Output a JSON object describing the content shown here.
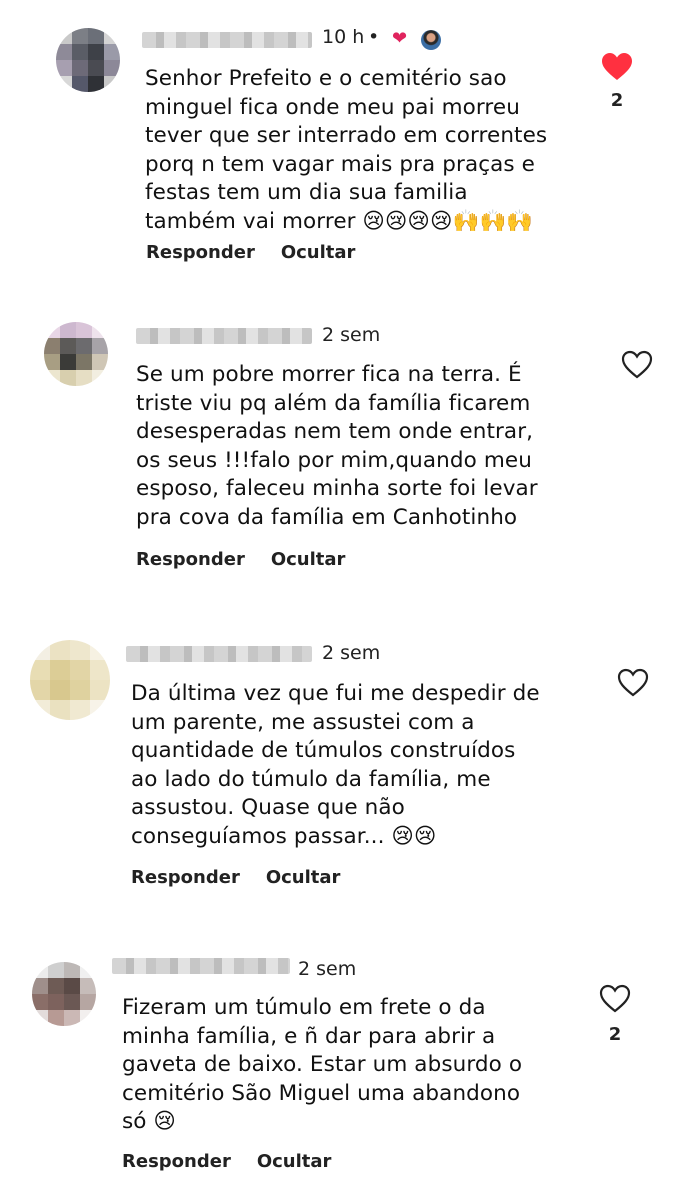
{
  "comments": [
    {
      "time": "10 h",
      "creator_liked": true,
      "text": "Senhor Prefeito e o cemitério sao\nminguel fica onde meu pai morreu\ntever que ser interrado em correntes\nporq n tem vagar mais pra praças e\nfestas tem um dia sua familia\ntambém vai morrer 😢😢😢😢🙌🙌🙌",
      "reply_label": "Responder",
      "hide_label": "Ocultar",
      "liked": true,
      "like_count": "2",
      "like_icon": "heart-filled"
    },
    {
      "time": "2 sem",
      "text": "Se um pobre morrer fica na terra. É\ntriste viu pq além da família ficarem\ndesesperadas nem tem onde entrar,\nos seus !!!falo por mim,quando meu\nesposo, faleceu minha sorte foi levar\npra cova da família em Canhotinho",
      "reply_label": "Responder",
      "hide_label": "Ocultar",
      "liked": false,
      "like_count": "",
      "like_icon": "heart-outline"
    },
    {
      "time": "2 sem",
      "text": "Da última vez que fui me despedir de\num parente, me assustei com a\nquantidade de túmulos construídos\nao lado do túmulo da família, me\nassustou. Quase que não\nconseguíamos passar... 😢😢",
      "reply_label": "Responder",
      "hide_label": "Ocultar",
      "liked": false,
      "like_count": "",
      "like_icon": "heart-outline"
    },
    {
      "time": "2 sem",
      "text": "Fizeram um túmulo em frete o da\nminha família, e ñ dar para abrir a\ngaveta de baixo. Estar um absurdo o\ncemitério São Miguel uma abandono\nsó 😢",
      "reply_label": "Responder",
      "hide_label": "Ocultar",
      "liked": false,
      "like_count": "2",
      "like_icon": "heart-outline"
    }
  ],
  "colors": {
    "like_red": "#ff3040",
    "text": "#111111",
    "muted": "#737373"
  }
}
